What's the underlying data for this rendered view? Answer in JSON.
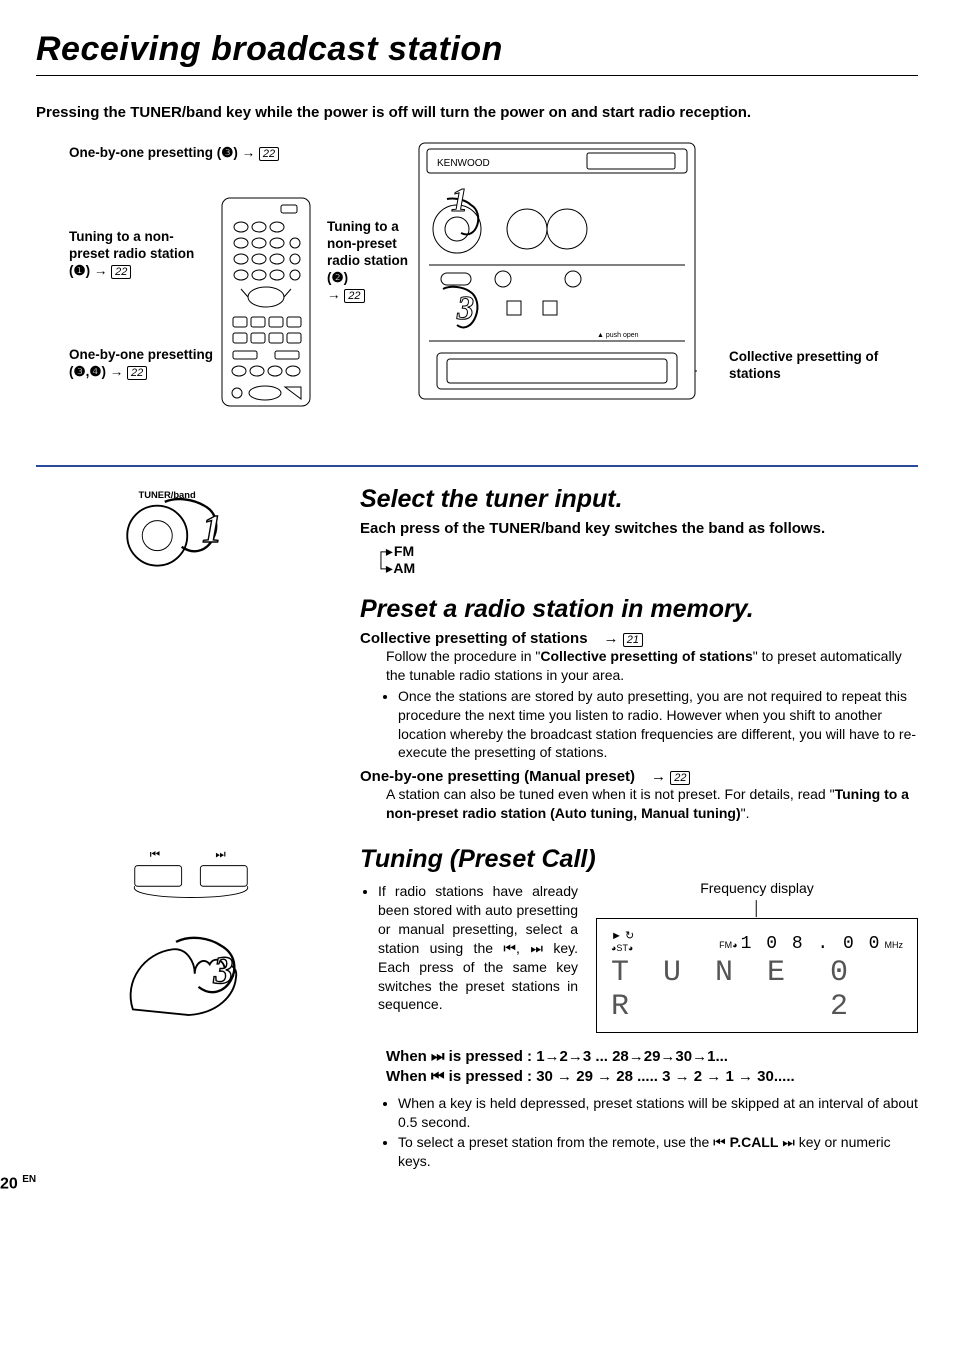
{
  "title": "Receiving broadcast station",
  "subtitle": "Pressing the TUNER/band key while the power is off will turn the power on and start radio reception.",
  "callouts": {
    "top_left": "One-by-one presetting (❸)",
    "mid_left": "Tuning to a non-preset radio station (❶)",
    "bottom_left": "One-by-one presetting (❸,❹)",
    "mid_center": "Tuning to a non-preset radio station (❷)",
    "right": "Collective presetting of stations",
    "page_ref": "22"
  },
  "device_brand": "KENWOOD",
  "push_open": "▲  push open",
  "step1": {
    "knob_label": "TUNER/band",
    "heading": "Select the tuner input.",
    "desc": "Each press of the TUNER/band key switches the band as follows.",
    "bands": {
      "a": "FM",
      "b": "AM"
    }
  },
  "step2": {
    "heading": "Preset a radio station in memory.",
    "collective": {
      "title": "Collective presetting of stations",
      "page_ref": "21",
      "para1a": "Follow the procedure in \"",
      "para1_bold": "Collective presetting of stations",
      "para1b": "\" to preset automatically the tunable radio stations in your area.",
      "bullet": "Once the stations are stored by auto presetting, you are not required to repeat this procedure the next time you listen to radio. However when you shift to another location whereby the broadcast station frequencies are different, you will have to re-execute the presetting of stations."
    },
    "manual": {
      "title": "One-by-one presetting (Manual preset)",
      "page_ref": "22",
      "para_a": "A station can also be tuned even when it is not preset.  For details, read \"",
      "para_bold": "Tuning to a non-preset radio station (Auto tuning, Manual tuning)",
      "para_b": "\"."
    }
  },
  "step3": {
    "heading": "Tuning (Preset Call)",
    "para": "If radio stations have already been stored with auto presetting or manual presetting, select a station using the ⏮, ⏭ key. Each press of the same key switches the preset stations in sequence.",
    "freq_label": "Frequency display",
    "display": {
      "indicators_left": "► ↻",
      "indicators_left2": "◕ST◕",
      "band_mark": "FM◕",
      "freq": "1 0 8 . 0 0",
      "unit": "MHz",
      "line2_left": "T U N E R",
      "line2_right": "0 2"
    },
    "seq": {
      "fwd_prefix": "When ⏭ is pressed : ",
      "fwd": "1→2→3 ... 28→29→30→1...",
      "rev_prefix": "When ⏮ is pressed : ",
      "rev": "30 → 29 → 28  .....  3 → 2 → 1 → 30....."
    },
    "bullets": {
      "b1": "When a key is held depressed, preset stations will be skipped at an interval of about 0.5 second.",
      "b2a": "To select a preset station from the remote, use the ⏮ ",
      "b2_bold": "P.CALL",
      "b2b": " ⏭ key or numeric keys."
    }
  },
  "page_number": "20",
  "page_lang": "EN"
}
